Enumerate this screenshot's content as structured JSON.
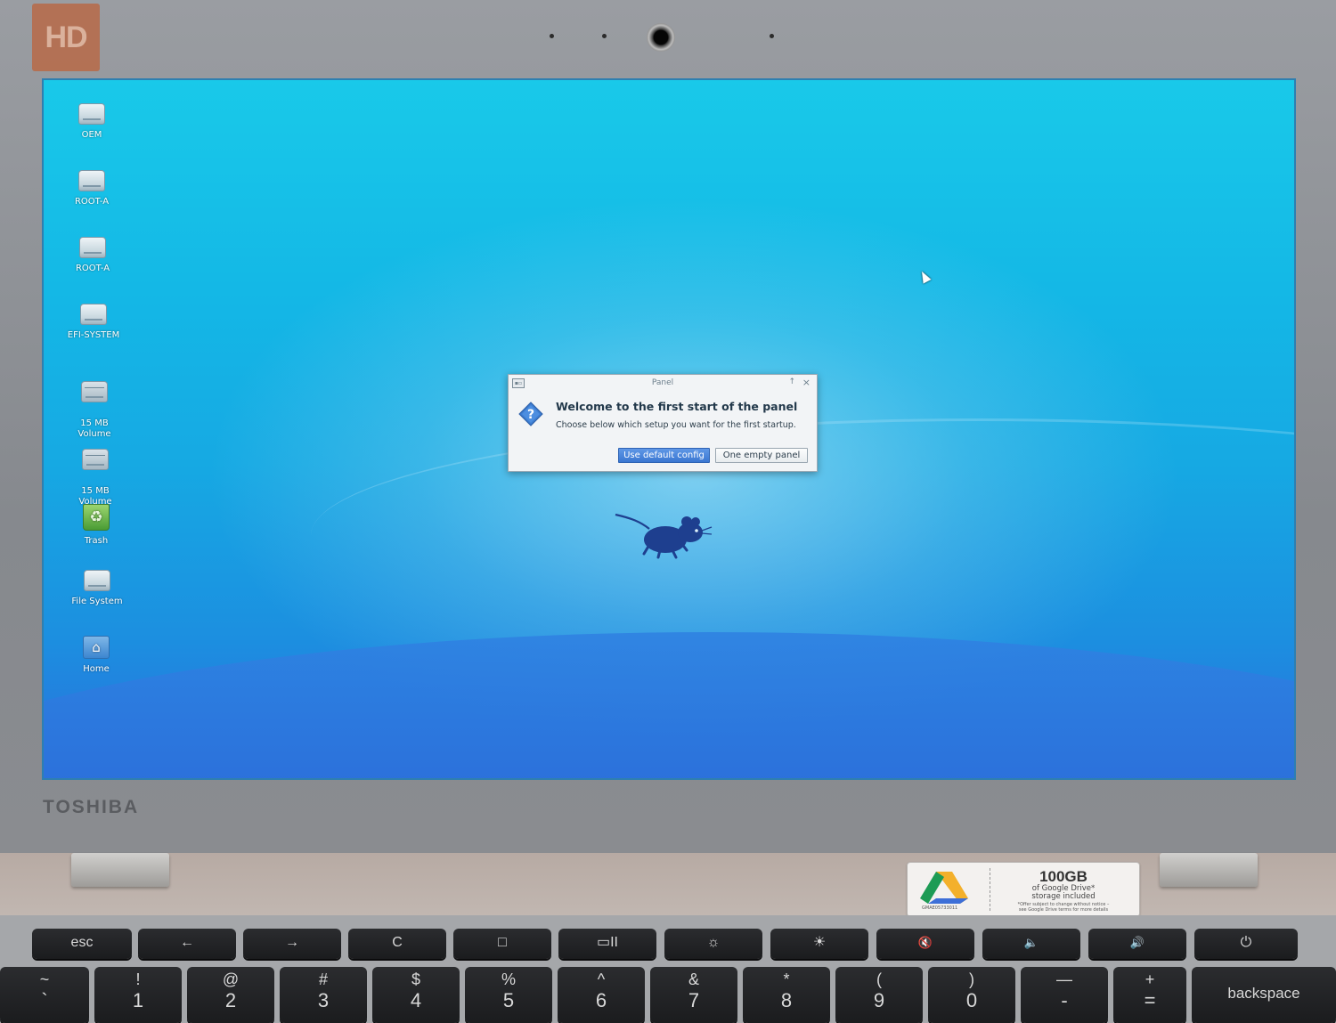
{
  "device": {
    "badge_text": "HD",
    "brand": "TOSHIBA"
  },
  "desktop": {
    "icons": [
      {
        "label": "OEM",
        "icon": "drive-icon"
      },
      {
        "label": "ROOT-A",
        "icon": "drive-icon"
      },
      {
        "label": "ROOT-A",
        "icon": "drive-icon"
      },
      {
        "label": "EFI-SYSTEM",
        "icon": "drive-icon"
      },
      {
        "label": "15 MB\nVolume",
        "icon": "drive-icon"
      },
      {
        "label": "15 MB\nVolume",
        "icon": "drive-icon"
      },
      {
        "label": "Trash",
        "icon": "trash-icon"
      },
      {
        "label": "File System",
        "icon": "drive-icon"
      },
      {
        "label": "Home",
        "icon": "home-folder-icon"
      }
    ]
  },
  "dialog": {
    "title": "Panel",
    "pin_glyph": "↑",
    "close_glyph": "×",
    "heading": "Welcome to the first start of the panel",
    "message": "Choose below which setup you want for the first startup.",
    "buttons": {
      "default": "Use default config",
      "empty": "One empty panel"
    }
  },
  "sticker": {
    "capacity": "100GB",
    "line1": "of Google Drive*",
    "line2": "storage included",
    "fine1": "*Offer subject to change without notice –",
    "fine2": "see Google Drive terms for more details",
    "code": "GMAE05733011"
  },
  "keyboard": {
    "function_row": [
      "esc",
      "←",
      "→",
      "C",
      "□",
      "▭II",
      "☼",
      "☀",
      "🔇",
      "🔈",
      "🔊",
      "⏻"
    ],
    "number_row": [
      {
        "top": "~",
        "bottom": "`"
      },
      {
        "top": "!",
        "bottom": "1"
      },
      {
        "top": "@",
        "bottom": "2"
      },
      {
        "top": "#",
        "bottom": "3"
      },
      {
        "top": "$",
        "bottom": "4"
      },
      {
        "top": "%",
        "bottom": "5"
      },
      {
        "top": "^",
        "bottom": "6"
      },
      {
        "top": "&",
        "bottom": "7"
      },
      {
        "top": "*",
        "bottom": "8"
      },
      {
        "top": "(",
        "bottom": "9"
      },
      {
        "top": ")",
        "bottom": "0"
      },
      {
        "top": "—",
        "bottom": "-"
      },
      {
        "top": "+",
        "bottom": "="
      }
    ],
    "backspace": "backspace"
  },
  "colors": {
    "desktop_top": "#19c9e9",
    "desktop_bottom": "#2a6fdc",
    "primary_button": "#3a77d2",
    "dialog_bg": "#f2f4f6"
  }
}
